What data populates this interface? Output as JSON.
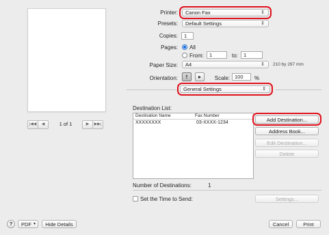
{
  "preview": {
    "pager": {
      "first": "|◀◀",
      "prev": "◀",
      "page_text": "1 of 1",
      "next": "▶",
      "last": "▶▶|"
    }
  },
  "printer": {
    "label": "Printer:",
    "value": "Canon Fax"
  },
  "presets": {
    "label": "Presets:",
    "value": "Default Settings"
  },
  "copies": {
    "label": "Copies:",
    "value": "1"
  },
  "pages": {
    "label": "Pages:",
    "all_label": "All",
    "from_label": "From:",
    "from_value": "1",
    "to_label": "to:",
    "to_value": "1",
    "selected": "All"
  },
  "paper_size": {
    "label": "Paper Size:",
    "value": "A4",
    "dims": "210 by 297 mm"
  },
  "orientation": {
    "label": "Orientation:",
    "selected": "portrait"
  },
  "scale": {
    "label": "Scale:",
    "value": "100",
    "unit": "%"
  },
  "section": {
    "value": "General Settings"
  },
  "destination": {
    "list_label": "Destination List:",
    "col_name": "Destination Name",
    "col_fax": "Fax Number",
    "rows": [
      {
        "name": "XXXXXXXX",
        "fax": "03-XXXX-1234"
      }
    ],
    "count_label": "Number of Destinations:",
    "count_value": "1"
  },
  "buttons": {
    "add": "Add Destination...",
    "address_book": "Address Book...",
    "edit": "Edit Destination...",
    "delete": "Delete",
    "settings": "Settings..."
  },
  "time_to_send": {
    "label": "Set the Time to Send:",
    "checked": false
  },
  "footer": {
    "help": "?",
    "pdf": "PDF",
    "hide_details": "Hide Details",
    "cancel": "Cancel",
    "print": "Print"
  },
  "colors": {
    "highlight": "#e0101c",
    "radio_selected": "#1d6fe0"
  },
  "icons": [
    "portrait-orientation-icon",
    "landscape-orientation-icon",
    "popup-arrow-icon",
    "pdf-dropdown-icon"
  ]
}
